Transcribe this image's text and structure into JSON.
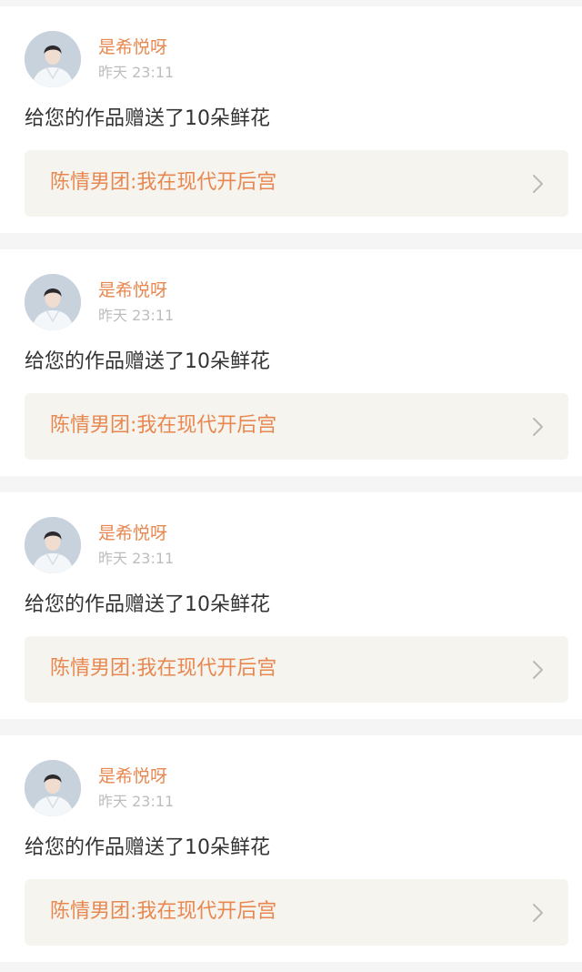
{
  "items": [
    {
      "username": "是希悦呀",
      "time": "昨天 23:11",
      "message": "给您的作品赠送了10朵鲜花",
      "work_title": "陈情男团:我在现代开后宫"
    },
    {
      "username": "是希悦呀",
      "time": "昨天 23:11",
      "message": "给您的作品赠送了10朵鲜花",
      "work_title": "陈情男团:我在现代开后宫"
    },
    {
      "username": "是希悦呀",
      "time": "昨天 23:11",
      "message": "给您的作品赠送了10朵鲜花",
      "work_title": "陈情男团:我在现代开后宫"
    },
    {
      "username": "是希悦呀",
      "time": "昨天 23:11",
      "message": "给您的作品赠送了10朵鲜花",
      "work_title": "陈情男团:我在现代开后宫"
    }
  ],
  "colors": {
    "accent": "#e8874f",
    "time_text": "#bdbdbd",
    "body_text": "#333333",
    "link_background": "#f5f4ef",
    "page_background": "#f5f5f5"
  },
  "icons": {
    "avatar": "user-avatar-photo",
    "chevron": "chevron-right-icon"
  }
}
